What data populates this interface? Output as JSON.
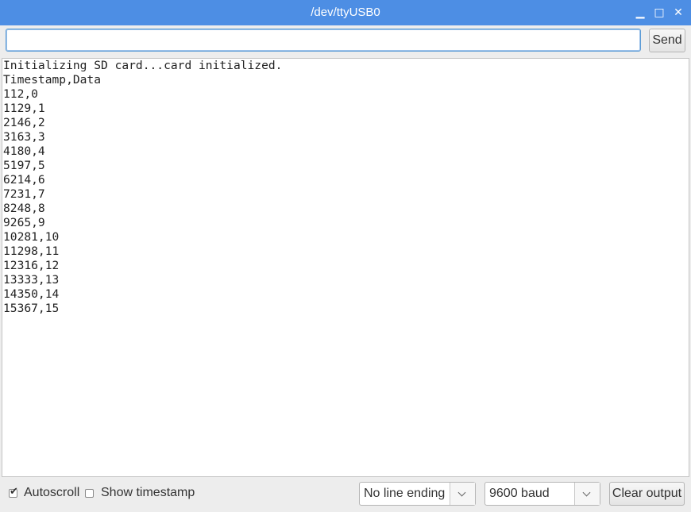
{
  "window": {
    "title": "/dev/ttyUSB0",
    "minimize_icon": "minimize-icon",
    "maximize_icon": "maximize-icon",
    "close_icon": "close-icon",
    "minimize_glyph": "▁",
    "maximize_glyph": "□",
    "close_glyph": "✕",
    "titlebar_color": "#4d8ee4"
  },
  "input": {
    "value": "",
    "send_label": "Send"
  },
  "output": {
    "lines": [
      "Initializing SD card...card initialized.",
      "Timestamp,Data",
      "112,0",
      "1129,1",
      "2146,2",
      "3163,3",
      "4180,4",
      "5197,5",
      "6214,6",
      "7231,7",
      "8248,8",
      "9265,9",
      "10281,10",
      "11298,11",
      "12316,12",
      "13333,13",
      "14350,14",
      "15367,15"
    ]
  },
  "footer": {
    "autoscroll_label": "Autoscroll",
    "autoscroll_checked": true,
    "check_glyph": "✔",
    "show_timestamp_label": "Show timestamp",
    "show_timestamp_checked": false,
    "line_ending_value": "No line ending",
    "baud_value": "9600 baud",
    "clear_output_label": "Clear output"
  }
}
